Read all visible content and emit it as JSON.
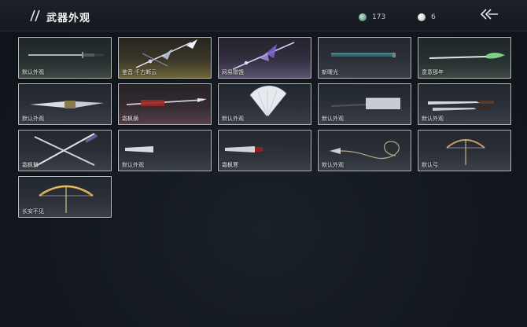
{
  "header": {
    "title": "武器外观",
    "currency_jade": "173",
    "currency_pearl": "6"
  },
  "items": [
    {
      "label": "默认外观"
    },
    {
      "label": "鉴音·千古断云"
    },
    {
      "label": "网易赠饿"
    },
    {
      "label": "新曙光"
    },
    {
      "label": "意意那年"
    },
    {
      "label": "默认外观"
    },
    {
      "label": "霜枫横"
    },
    {
      "label": "默认外观"
    },
    {
      "label": "默认外观"
    },
    {
      "label": "默认外观"
    },
    {
      "label": "霜枫舞"
    },
    {
      "label": "默认外观"
    },
    {
      "label": "霜枫寒"
    },
    {
      "label": "默认外观"
    },
    {
      "label": "默认弓"
    },
    {
      "label": "长安不见"
    }
  ],
  "colors": {
    "background": "#131820",
    "card_border": "#b7bcc2",
    "text": "#e8e8e8"
  },
  "icons": [
    "slash-icon",
    "jade-coin-icon",
    "pearl-icon",
    "back-arrow-icon"
  ]
}
